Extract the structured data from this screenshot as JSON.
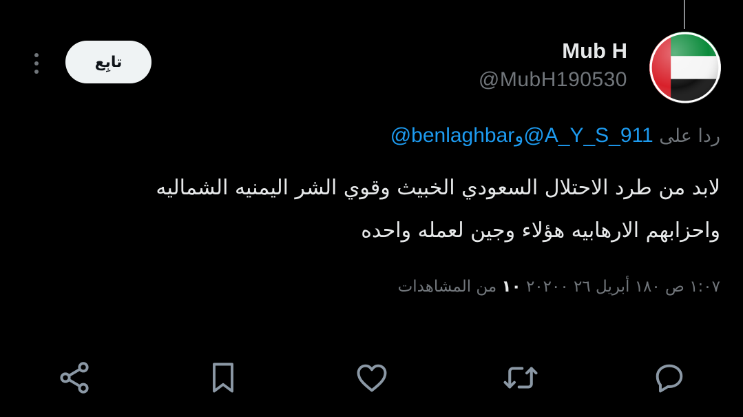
{
  "user": {
    "display_name": "Mub H",
    "handle": "@MubH190530"
  },
  "follow_button": {
    "label": "تابِع"
  },
  "reply_to": {
    "prefix": "ردا على",
    "mention_1": "@A_Y_S_911",
    "conjunction": "و",
    "mention_2": "@benlaghbar"
  },
  "tweet": {
    "line_1": "لابد من طرد الاحتلال السعودي الخبيث وقوي الشر اليمنيه الشماليه",
    "line_2": "واحزابهم  الارهابيه  هؤلاء وجين لعمله واحده"
  },
  "meta": {
    "datetime": "١:٠٧ ص ١٨٠ أبريل ٢٦ ٢٠٢٠٠",
    "views_count": "١٠",
    "views_label": "من المشاهدات"
  },
  "actions": [
    {
      "name": "reply",
      "icon": "reply-icon"
    },
    {
      "name": "repost",
      "icon": "repost-icon"
    },
    {
      "name": "like",
      "icon": "heart-icon"
    },
    {
      "name": "bookmark",
      "icon": "bookmark-icon"
    },
    {
      "name": "share",
      "icon": "share-icon"
    }
  ],
  "colors": {
    "background": "#000000",
    "text": "#e7e9ea",
    "muted": "#71767b",
    "link": "#1d9bf0",
    "button_bg": "#eff3f4"
  }
}
